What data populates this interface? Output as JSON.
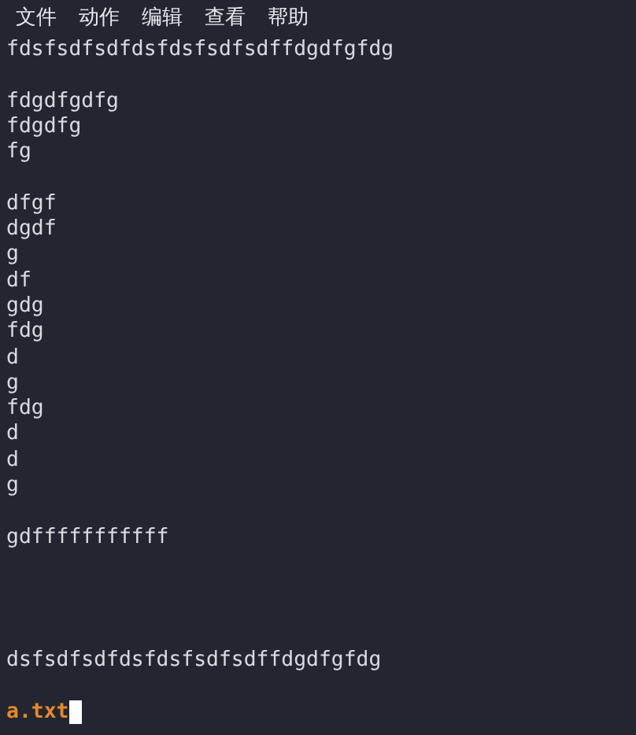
{
  "menu": [
    "文件",
    "动作",
    "编辑",
    "查看",
    "帮助"
  ],
  "blocks": [
    {
      "kind": "body",
      "lines": [
        "fdsfsdfsdfdsfdsfsdfsdffdgdfgfdg"
      ]
    },
    {
      "kind": "body",
      "lines": [
        "fdgdfgdfg",
        "fdgdfg",
        "fg"
      ]
    },
    {
      "kind": "body",
      "lines": [
        "dfgf",
        "dgdf",
        "g",
        "df",
        "gdg",
        "fdg",
        "d",
        "g",
        "fdg",
        "d",
        "d",
        "g"
      ]
    },
    {
      "kind": "body",
      "lines": [
        "gdfffffffffff"
      ]
    },
    {
      "kind": "tail",
      "lines": [
        "dsfsdfsdfdsfdsfsdfsdffdgdfgfdg"
      ]
    }
  ],
  "status": {
    "filename": "a.txt"
  }
}
